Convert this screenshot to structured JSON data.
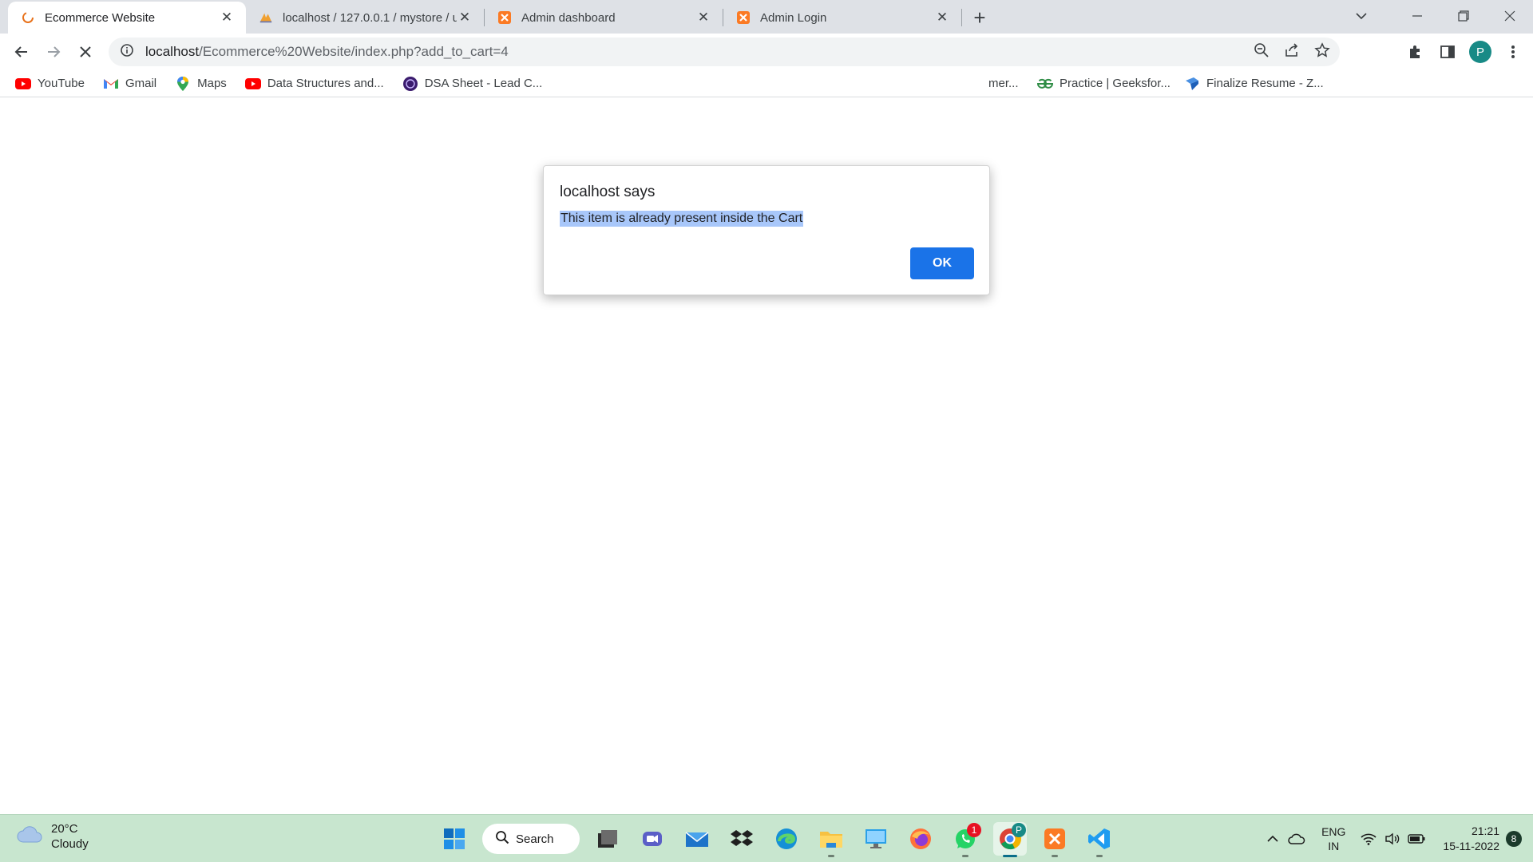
{
  "browser": {
    "tabs": [
      {
        "title": "Ecommerce Website",
        "favicon": "loading-favicon",
        "active": true
      },
      {
        "title": "localhost / 127.0.0.1 / mystore / u",
        "favicon": "phpmyadmin-icon",
        "active": false
      },
      {
        "title": "Admin dashboard",
        "favicon": "xampp-icon",
        "active": false
      },
      {
        "title": "Admin Login",
        "favicon": "xampp-icon",
        "active": false
      }
    ],
    "close_glyph": "✕",
    "new_tab_glyph": "+",
    "address": {
      "host": "localhost",
      "path": "/Ecommerce%20Website/index.php?add_to_cart=4"
    },
    "profile_initial": "P",
    "bookmarks": [
      {
        "label": "YouTube",
        "icon": "youtube-icon"
      },
      {
        "label": "Gmail",
        "icon": "gmail-icon"
      },
      {
        "label": "Maps",
        "icon": "maps-icon"
      },
      {
        "label": "Data Structures and...",
        "icon": "youtube-icon"
      },
      {
        "label": "DSA Sheet - Lead C...",
        "icon": "dsa-icon"
      },
      {
        "label": "mer...",
        "icon": ""
      },
      {
        "label": "Practice | Geeksfor...",
        "icon": "geeksforgeeks-icon"
      },
      {
        "label": "Finalize Resume - Z...",
        "icon": "zety-icon"
      }
    ]
  },
  "dialog": {
    "title": "localhost says",
    "message": "This item is already present inside the Cart",
    "ok_label": "OK"
  },
  "taskbar": {
    "weather": {
      "temp": "20°C",
      "condition": "Cloudy"
    },
    "search_label": "Search",
    "whatsapp_badge": "1",
    "chrome_badge": "P",
    "tray": {
      "lang_line1": "ENG",
      "lang_line2": "IN",
      "time": "21:21",
      "date": "15-11-2022",
      "notifications": "8"
    }
  },
  "colors": {
    "accent": "#1a73e8",
    "tabstrip": "#dee1e6",
    "taskbar": "#c8e6cf",
    "selection": "#a8c7fa"
  }
}
